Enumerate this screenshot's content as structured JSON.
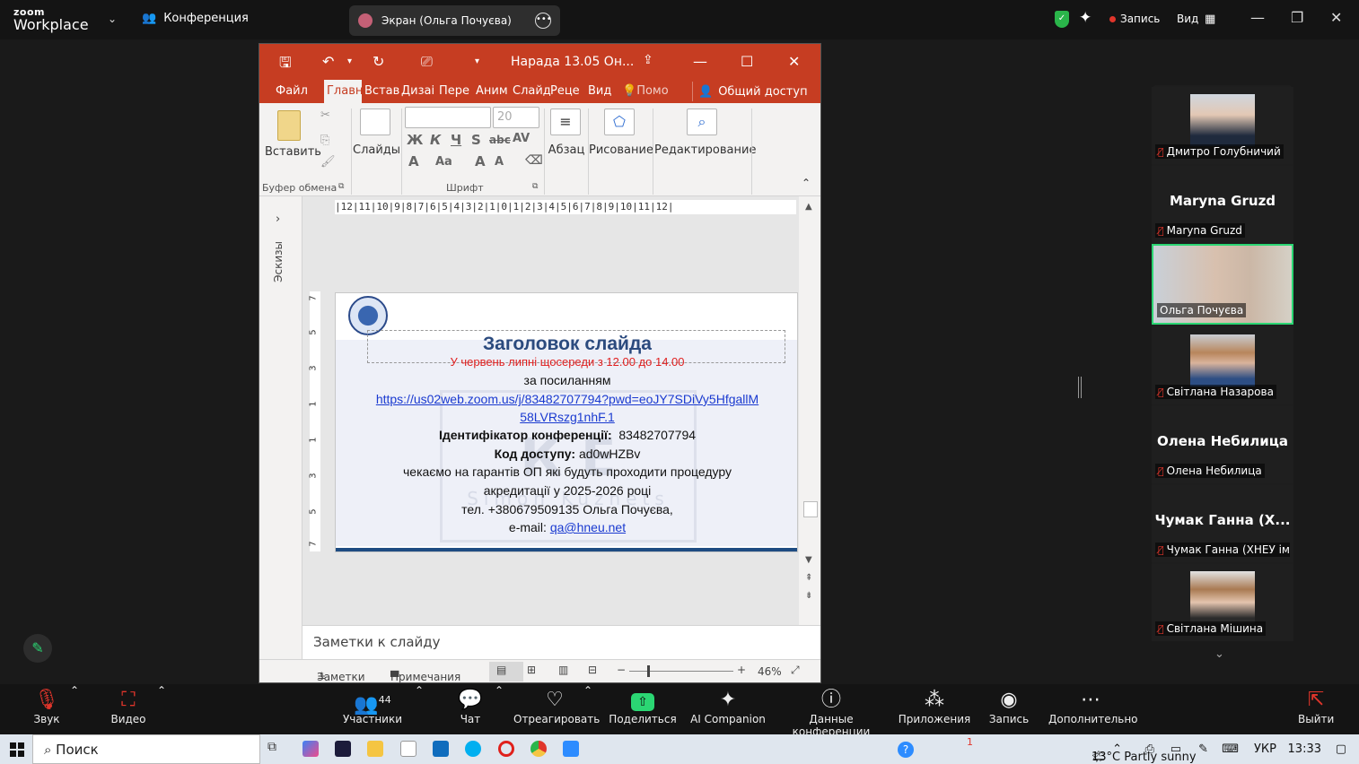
{
  "zoom": {
    "logo_top": "zoom",
    "logo_bottom": "Workplace",
    "conference_label": "Конференция",
    "screen_label": "Экран (Ольга Почуєва)",
    "record_label": "Запись",
    "view_label": "Вид"
  },
  "ppt": {
    "doc_title": "Нарада 13.05 Он...",
    "tabs": [
      "Файл",
      "Главн",
      "Встав",
      "Дизаі",
      "Пере",
      "Аним",
      "Слайд",
      "Реце",
      "Вид",
      "Помо"
    ],
    "share_label": "Общий доступ",
    "ribbon": {
      "paste": "Вставить",
      "clipboard": "Буфер обмена",
      "slides": "Слайды",
      "font_group": "Шрифт",
      "font_size": "20",
      "paragraph": "Абзац",
      "drawing": "Рисование",
      "editing": "Редактирование"
    },
    "thumbnails_label": "Эскизы",
    "ruler": "|12|11|10|9|8|7|6|5|4|3|2|1|0|1|2|3|4|5|6|7|8|9|10|11|12|",
    "slide": {
      "title": "Заголовок слайда",
      "line1": "У червень липні щосереди з 12.00 до 14.00",
      "line2": "за посиланням",
      "link1": "https://us02web.zoom.us/j/83482707794?pwd=eoJY7SDiVy5HfgallM",
      "link2": "58LVRszg1nhF.1",
      "id_label": "Ідентифікатор конференції:",
      "id_value": "83482707794",
      "code_label": "Код доступу:",
      "code_value": "ad0wHZBv",
      "line6": "чекаємо на гарантів ОП які будуть проходити процедуру",
      "line7": "акредитації у 2025-2026 році",
      "line8": "тел. +380679509135 Ольга Почуєва,",
      "email_label": "e-mail:",
      "email_value": "qa@hneu.net",
      "watermark": "К  Е",
      "watermark_sub": "Simon Kuznets"
    },
    "notes_placeholder": "Заметки к слайду",
    "status": {
      "notes": "Заметки",
      "comments": "Примечания",
      "zoom": "46%"
    }
  },
  "participants": [
    {
      "name": "Дмитро Голубничий",
      "has_photo": true
    },
    {
      "name": "Maryna Gruzd",
      "big": "Maryna Gruzd",
      "has_photo": false
    },
    {
      "name": "Ольга Почуєва",
      "has_photo": true,
      "active": true
    },
    {
      "name": "Світлана Назарова",
      "has_photo": true
    },
    {
      "name": "Олена Небилица",
      "big": "Олена Небилица",
      "has_photo": false
    },
    {
      "name": "Чумак Ганна (ХНЕУ ім...",
      "big": "Чумак Ганна (Х...",
      "has_photo": false
    },
    {
      "name": "Світлана Мішина",
      "has_photo": true
    }
  ],
  "toolbar": {
    "audio": "Звук",
    "video": "Видео",
    "participants": "Участники",
    "participants_count": "44",
    "chat": "Чат",
    "react": "Отреагировать",
    "share": "Поделиться",
    "companion": "AI Companion",
    "meeting_info": "Данные конференции",
    "apps": "Приложения",
    "record": "Запись",
    "more": "Дополнительно",
    "leave": "Выйти"
  },
  "taskbar": {
    "search": "Поиск",
    "weather": "13°C  Partly sunny",
    "lang": "УКР",
    "time": "13:33",
    "notif_count": "1"
  }
}
